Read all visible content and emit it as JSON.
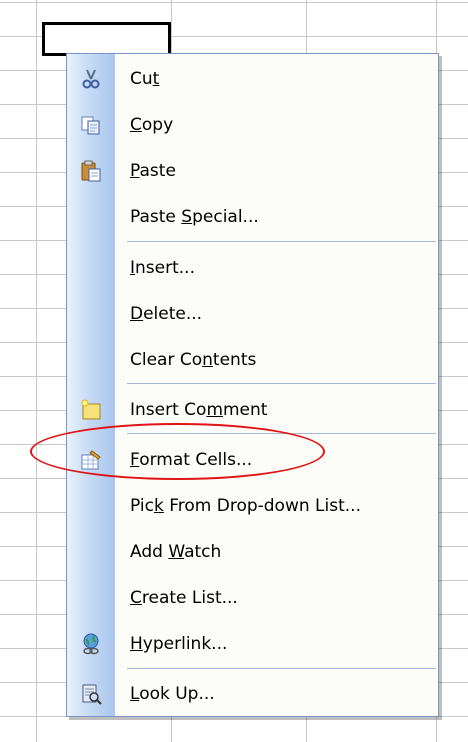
{
  "menu": {
    "items": [
      {
        "id": "cut",
        "pre": "Cu",
        "key": "t",
        "post": "",
        "icon": "scissors-icon"
      },
      {
        "id": "copy",
        "pre": "",
        "key": "C",
        "post": "opy",
        "icon": "copy-icon"
      },
      {
        "id": "paste",
        "pre": "",
        "key": "P",
        "post": "aste",
        "icon": "paste-icon"
      },
      {
        "id": "paste_special",
        "pre": "Paste ",
        "key": "S",
        "post": "pecial...",
        "icon": ""
      },
      {
        "id": "insert",
        "pre": "",
        "key": "I",
        "post": "nsert...",
        "icon": ""
      },
      {
        "id": "delete",
        "pre": "",
        "key": "D",
        "post": "elete...",
        "icon": ""
      },
      {
        "id": "clear_contents",
        "pre": "Clear Co",
        "key": "n",
        "post": "tents",
        "icon": ""
      },
      {
        "id": "insert_comment",
        "pre": "Insert Co",
        "key": "m",
        "post": "ment",
        "icon": "comment-icon"
      },
      {
        "id": "format_cells",
        "pre": "",
        "key": "F",
        "post": "ormat Cells...",
        "icon": "format-cells-icon"
      },
      {
        "id": "pick_list",
        "pre": "Pic",
        "key": "k",
        "post": " From Drop-down List...",
        "icon": ""
      },
      {
        "id": "add_watch",
        "pre": "Add ",
        "key": "W",
        "post": "atch",
        "icon": ""
      },
      {
        "id": "create_list",
        "pre": "",
        "key": "C",
        "post": "reate List...",
        "icon": ""
      },
      {
        "id": "hyperlink",
        "pre": "",
        "key": "H",
        "post": "yperlink...",
        "icon": "hyperlink-icon"
      },
      {
        "id": "look_up",
        "pre": "",
        "key": "L",
        "post": "ook Up...",
        "icon": "research-icon"
      }
    ]
  },
  "colors": {
    "highlight": "#e01414",
    "menu_border": "#7a96c4",
    "gutter": "#c7dbf5"
  }
}
